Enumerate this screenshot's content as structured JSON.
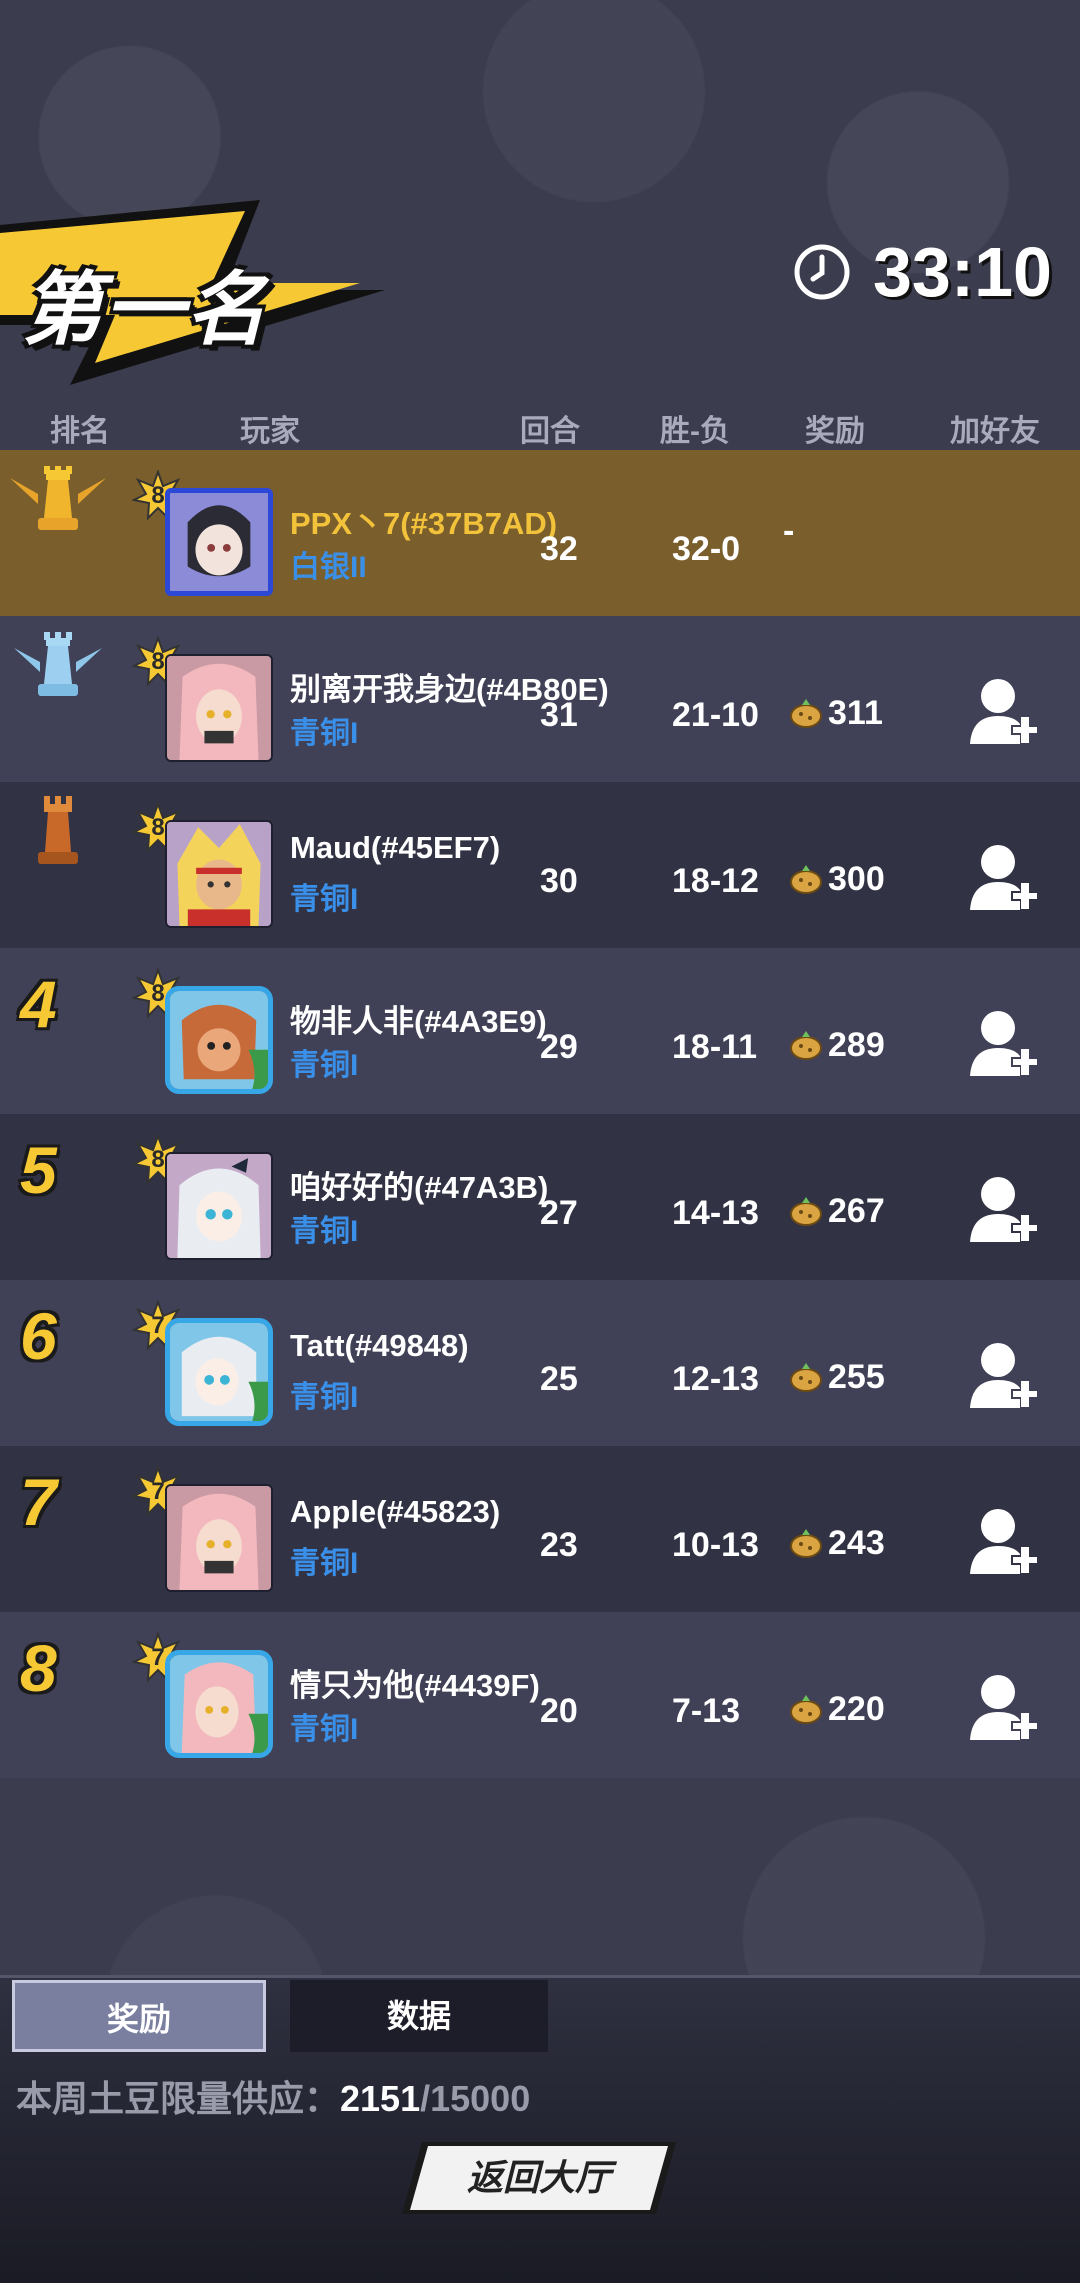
{
  "banner": {
    "title": "第一名"
  },
  "timer": {
    "value": "33:10"
  },
  "header": {
    "rank": "排名",
    "player": "玩家",
    "rounds": "回合",
    "win_loss": "胜-负",
    "reward": "奖励",
    "add_friend": "加好友"
  },
  "rows": [
    {
      "rank": "1",
      "rank_icon": "gold-crown-icon",
      "level": "8",
      "name": "PPX丶7(#37B7AD)",
      "tier": "白银II",
      "rounds": "32",
      "win_loss": "32-0",
      "reward": "-",
      "self": true
    },
    {
      "rank": "2",
      "rank_icon": "silver-crown-icon",
      "level": "8",
      "name": "别离开我身边(#4B80E)",
      "tier": "青铜I",
      "rounds": "31",
      "win_loss": "21-10",
      "reward": "311"
    },
    {
      "rank": "3",
      "rank_icon": "bronze-rook-icon",
      "level": "8",
      "name": "Maud(#45EF7)",
      "tier": "青铜I",
      "rounds": "30",
      "win_loss": "18-12",
      "reward": "300"
    },
    {
      "rank": "4",
      "level": "8",
      "name": "物非人非(#4A3E9)",
      "tier": "青铜I",
      "rounds": "29",
      "win_loss": "18-11",
      "reward": "289"
    },
    {
      "rank": "5",
      "level": "8",
      "name": "咱好好的(#47A3B)",
      "tier": "青铜I",
      "rounds": "27",
      "win_loss": "14-13",
      "reward": "267"
    },
    {
      "rank": "6",
      "level": "7",
      "name": "Tatt(#49848)",
      "tier": "青铜I",
      "rounds": "25",
      "win_loss": "12-13",
      "reward": "255"
    },
    {
      "rank": "7",
      "level": "7",
      "name": "Apple(#45823)",
      "tier": "青铜I",
      "rounds": "23",
      "win_loss": "10-13",
      "reward": "243"
    },
    {
      "rank": "8",
      "level": "7",
      "name": "情只为他(#4439F)",
      "tier": "青铜I",
      "rounds": "20",
      "win_loss": "7-13",
      "reward": "220"
    }
  ],
  "tabs": {
    "reward": "奖励",
    "data": "数据"
  },
  "supply": {
    "label": "本周土豆限量供应：",
    "current": "2151",
    "max": "/15000"
  },
  "back_button": "返回大厅",
  "colors": {
    "accent_gold": "#f6c934",
    "tier_blue": "#3a8fe8",
    "self_row": "#7a5f2c"
  }
}
